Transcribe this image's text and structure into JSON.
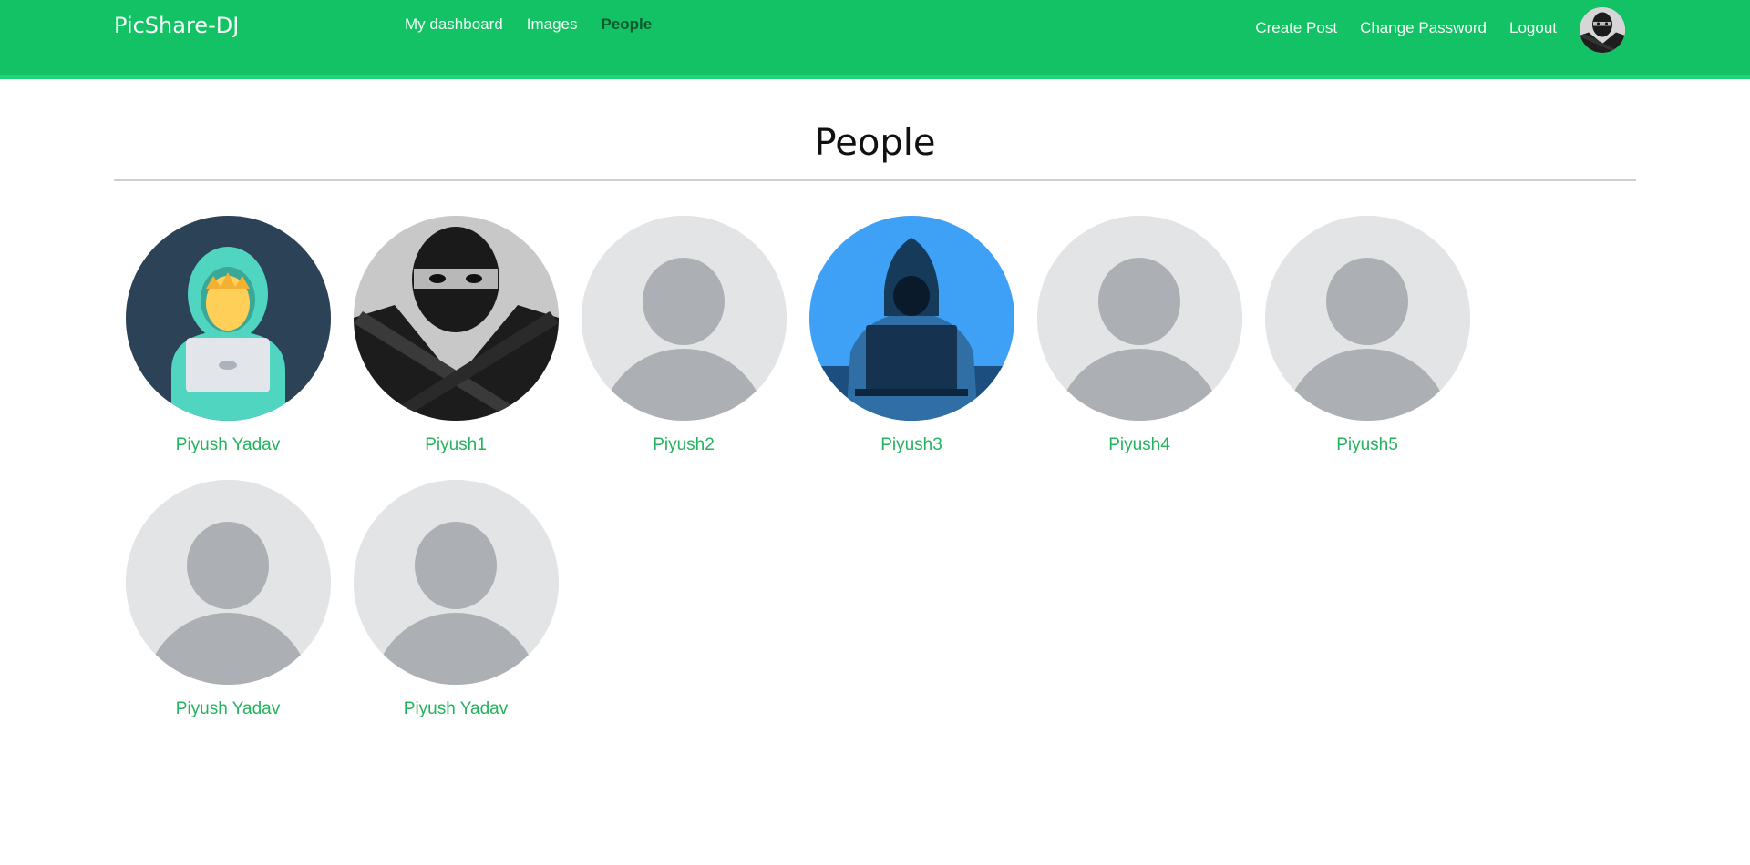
{
  "navbar": {
    "brand": "PicShare-DJ",
    "links": [
      {
        "label": "My dashboard"
      },
      {
        "label": "Images"
      },
      {
        "label": "People"
      }
    ],
    "right_links": [
      {
        "label": "Create Post"
      },
      {
        "label": "Change Password"
      },
      {
        "label": "Logout"
      }
    ],
    "avatar_icon": "ninja-avatar"
  },
  "page": {
    "title": "People"
  },
  "people": [
    {
      "name": "Piyush Yadav",
      "avatar": "hacker-hoodie-icon"
    },
    {
      "name": "Piyush1",
      "avatar": "ninja-avatar"
    },
    {
      "name": "Piyush2",
      "avatar": "default-user-avatar"
    },
    {
      "name": "Piyush3",
      "avatar": "hooded-hacker-laptop-avatar"
    },
    {
      "name": "Piyush4",
      "avatar": "default-user-avatar"
    },
    {
      "name": "Piyush5",
      "avatar": "default-user-avatar"
    },
    {
      "name": "Piyush Yadav",
      "avatar": "default-user-avatar"
    },
    {
      "name": "Piyush Yadav",
      "avatar": "default-user-avatar"
    }
  ],
  "colors": {
    "navbar_bg": "#12c264",
    "accent": "#24b35d",
    "active_link": "#0b5a2c"
  }
}
